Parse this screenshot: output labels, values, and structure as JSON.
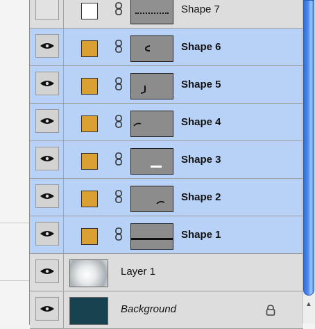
{
  "layers": [
    {
      "name": "Shape 7",
      "selected": false,
      "visible": false,
      "swatch_color": "#ffffff",
      "mask": "dotted-line"
    },
    {
      "name": "Shape 6",
      "selected": true,
      "visible": true,
      "swatch_color": "#dba032",
      "mask": "small-mark"
    },
    {
      "name": "Shape 5",
      "selected": true,
      "visible": true,
      "swatch_color": "#dba032",
      "mask": "hook"
    },
    {
      "name": "Shape 4",
      "selected": true,
      "visible": true,
      "swatch_color": "#dba032",
      "mask": "arc-left"
    },
    {
      "name": "Shape 3",
      "selected": true,
      "visible": true,
      "swatch_color": "#dba032",
      "mask": "line-right"
    },
    {
      "name": "Shape 2",
      "selected": true,
      "visible": true,
      "swatch_color": "#dba032",
      "mask": "arc-right"
    },
    {
      "name": "Shape 1",
      "selected": true,
      "visible": true,
      "swatch_color": "#dba032",
      "mask": "long-line"
    }
  ],
  "layer1": {
    "name": "Layer 1"
  },
  "background_layer": {
    "name": "Background",
    "locked": true
  },
  "colors": {
    "selection": "#b7d2f6",
    "scrollbar": "#3a7ee6"
  }
}
